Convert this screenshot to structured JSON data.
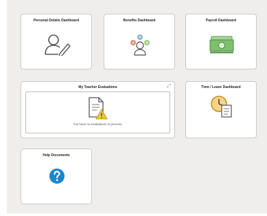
{
  "tiles": {
    "personal": {
      "title": "Personal Details Dashboard",
      "icon": "person-edit-icon"
    },
    "benefits": {
      "title": "Benefits Dashboard",
      "icon": "benefits-people-icon"
    },
    "payroll": {
      "title": "Payroll Dashboard",
      "icon": "money-icon"
    },
    "evaluations": {
      "title": "My Teacher Evaluations",
      "icon": "document-warning-icon",
      "message": "You have no evaluations in process.",
      "expand_icon": "expand-arrows-icon"
    },
    "time_leave": {
      "title": "Time / Leave Dashboard",
      "icon": "clock-document-icon"
    },
    "help": {
      "title": "Help Documents",
      "icon": "question-circle-icon"
    }
  },
  "colors": {
    "background": "#efeeec",
    "tile": "#ffffff",
    "help_blue": "#1a86d0",
    "money_green": "#5a9e4b",
    "clock_orange": "#e9a63a",
    "warning_yellow": "#f3c63a"
  }
}
